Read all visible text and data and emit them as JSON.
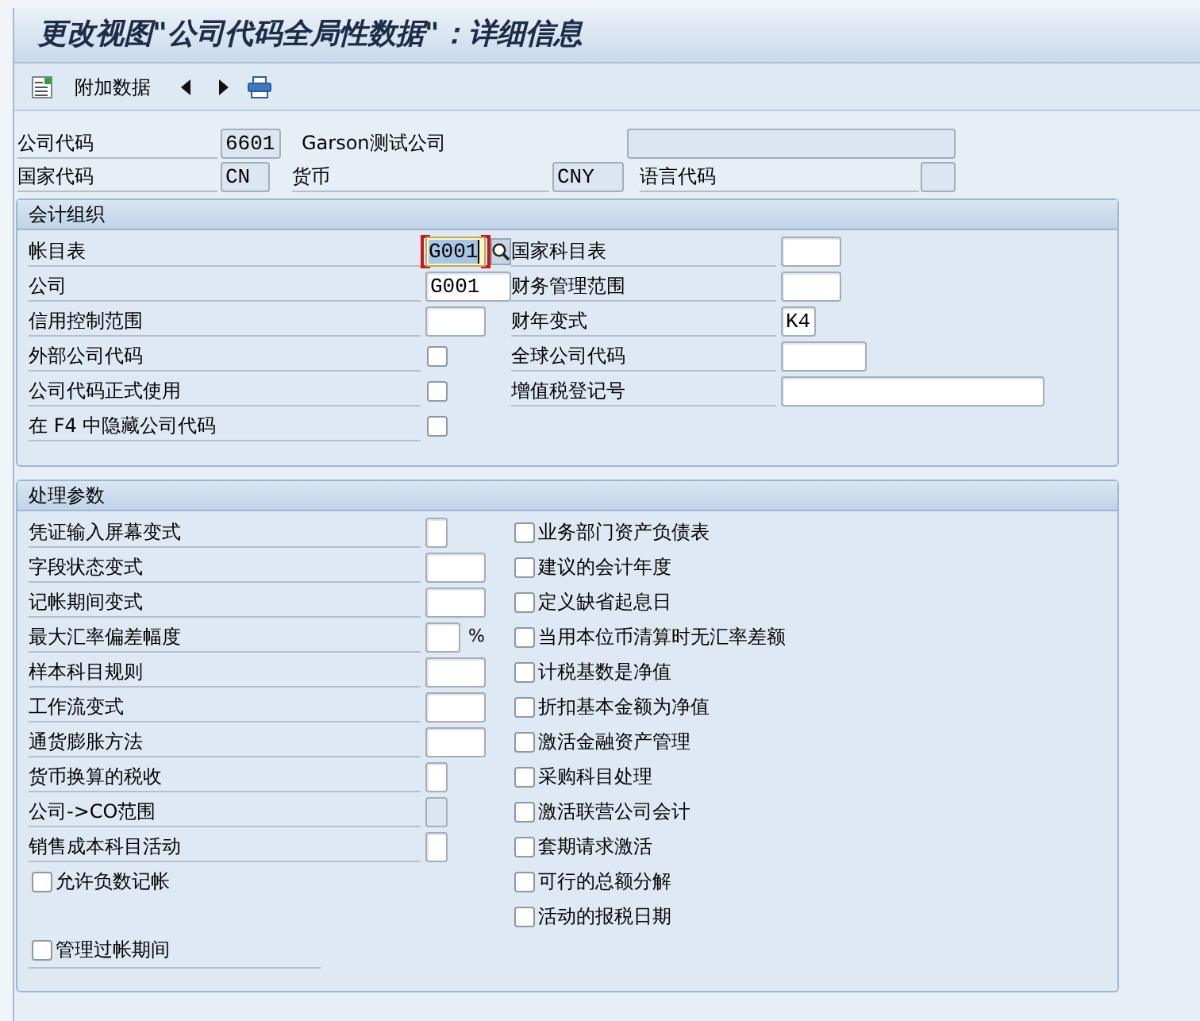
{
  "window": {
    "title": "更改视图\"公司代码全局性数据\"：详细信息"
  },
  "toolbar": {
    "buttons": [
      {
        "kind": "details",
        "label": "附加数据"
      },
      {
        "kind": "previous"
      },
      {
        "kind": "next"
      },
      {
        "kind": "print"
      }
    ]
  },
  "header": {
    "rows": [
      [
        {
          "kind": "label",
          "text": "公司代码"
        },
        {
          "kind": "field",
          "value": "6601",
          "disabled": true
        },
        {
          "kind": "text",
          "text": "Garson测试公司"
        },
        {
          "kind": "field",
          "disabled": true
        }
      ],
      [
        {
          "kind": "label",
          "text": "国家代码"
        },
        {
          "kind": "field",
          "value": "CN",
          "disabled": true
        },
        {
          "kind": "label",
          "text": "货币"
        },
        {
          "kind": "field",
          "value": "CNY",
          "disabled": true
        },
        {
          "kind": "label",
          "text": "语言代码"
        },
        {
          "kind": "field",
          "disabled": true
        }
      ]
    ]
  },
  "groups": [
    {
      "title": "会计组织",
      "left": [
        {
          "kind": "field",
          "label": "帐目表",
          "value": "G001",
          "disabled": false,
          "focused": true
        },
        {
          "kind": "field",
          "label": "公司",
          "value": "G001",
          "disabled": false,
          "focused": false
        },
        {
          "kind": "field",
          "label": "信用控制范围",
          "disabled": false,
          "focused": false
        },
        {
          "kind": "checkbox",
          "label": "外部公司代码",
          "checked": false,
          "focused": false
        },
        {
          "kind": "checkbox",
          "label": "公司代码正式使用",
          "checked": false,
          "focused": false
        },
        {
          "kind": "checkbox",
          "label": "在 F4 中隐藏公司代码",
          "checked": false,
          "focused": false
        }
      ],
      "right": [
        {
          "kind": "field",
          "label": "国家科目表",
          "disabled": false
        },
        {
          "kind": "field",
          "label": "财务管理范围",
          "disabled": false
        },
        {
          "kind": "field",
          "label": "财年变式",
          "value": "K4",
          "disabled": false
        },
        {
          "kind": "field",
          "label": "全球公司代码",
          "disabled": false
        },
        {
          "kind": "field",
          "label": "增值税登记号",
          "disabled": false
        }
      ]
    },
    {
      "title": "处理参数",
      "left": [
        {
          "kind": "field",
          "label": "凭证输入屏幕变式",
          "disabled": false
        },
        {
          "kind": "field",
          "label": "字段状态变式",
          "disabled": false
        },
        {
          "kind": "field",
          "label": "记帐期间变式",
          "disabled": false
        },
        {
          "kind": "field",
          "label": "最大汇率偏差幅度",
          "disabled": false,
          "unit": "%"
        },
        {
          "kind": "field",
          "label": "样本科目规则",
          "disabled": false
        },
        {
          "kind": "field",
          "label": "工作流变式",
          "disabled": false
        },
        {
          "kind": "field",
          "label": "通货膨胀方法",
          "disabled": false
        },
        {
          "kind": "field",
          "label": "货币换算的税收",
          "disabled": false
        },
        {
          "kind": "field",
          "label": "公司->CO范围",
          "disabled": true
        },
        {
          "kind": "field",
          "label": "销售成本科目活动",
          "disabled": false
        },
        {
          "kind": "option",
          "label": "允许负数记帐",
          "checked": false
        }
      ],
      "bottom": [
        {
          "kind": "option",
          "label": "管理过帐期间",
          "checked": false
        }
      ],
      "right": [
        {
          "kind": "option",
          "label": "业务部门资产负债表",
          "checked": false
        },
        {
          "kind": "option",
          "label": "建议的会计年度",
          "checked": false
        },
        {
          "kind": "option",
          "label": "定义缺省起息日",
          "checked": false
        },
        {
          "kind": "option",
          "label": "当用本位币清算时无汇率差额",
          "checked": false
        },
        {
          "kind": "option",
          "label": "计税基数是净值",
          "checked": false
        },
        {
          "kind": "option",
          "label": "折扣基本金额为净值",
          "checked": false
        },
        {
          "kind": "option",
          "label": "激活金融资产管理",
          "checked": false
        },
        {
          "kind": "option",
          "label": "采购科目处理",
          "checked": false
        },
        {
          "kind": "option",
          "label": "激活联营公司会计",
          "checked": false
        },
        {
          "kind": "option",
          "label": "套期请求激活",
          "checked": false
        },
        {
          "kind": "option",
          "label": "可行的总额分解",
          "checked": false
        },
        {
          "kind": "option",
          "label": "活动的报税日期",
          "checked": false
        }
      ]
    }
  ]
}
